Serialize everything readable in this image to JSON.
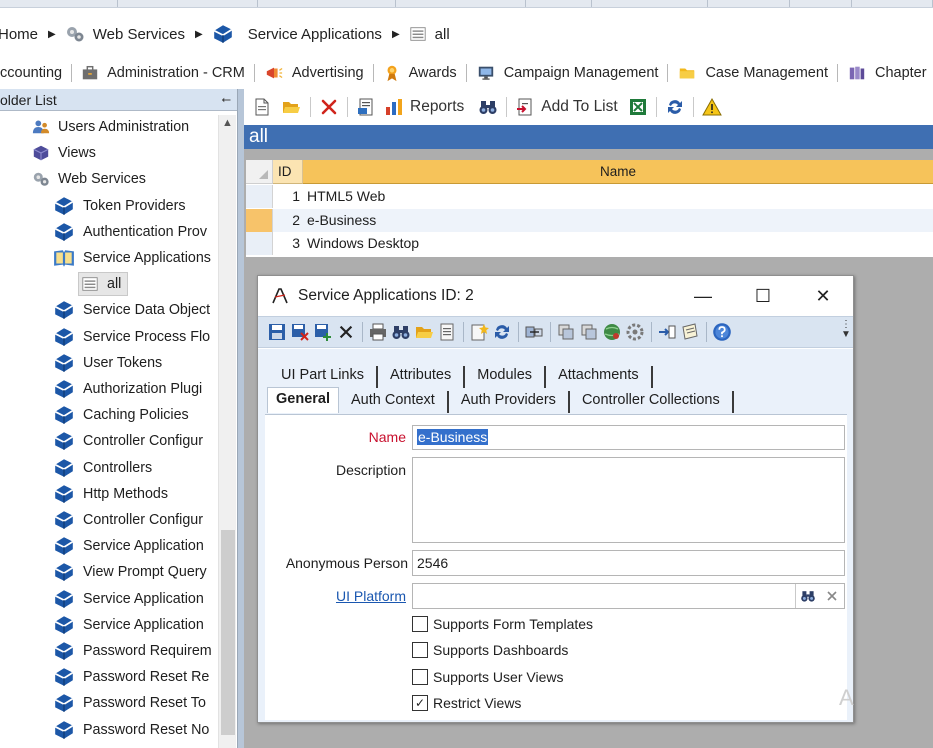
{
  "breadcrumb": {
    "items": [
      {
        "label": "Home",
        "icon": "home-icon"
      },
      {
        "label": "Web Services",
        "icon": "gears-icon"
      },
      {
        "label": "Service Applications",
        "icon": "book-icon"
      },
      {
        "label": "all",
        "icon": "list-view-icon"
      }
    ]
  },
  "navbar": {
    "items": [
      {
        "label": "ccounting",
        "icon": "none"
      },
      {
        "label": "Administration - CRM",
        "icon": "briefcase-icon"
      },
      {
        "label": "Advertising",
        "icon": "megaphone-icon"
      },
      {
        "label": "Awards",
        "icon": "ribbon-icon"
      },
      {
        "label": "Campaign Management",
        "icon": "monitor-icon"
      },
      {
        "label": "Case Management",
        "icon": "folder-icon"
      },
      {
        "label": "Chapter",
        "icon": "books-icon"
      }
    ]
  },
  "folder_panel": {
    "title": "older List",
    "items": [
      {
        "label": "Users Administration",
        "icon": "users-icon",
        "level": 1
      },
      {
        "label": "Views",
        "icon": "cube-icon",
        "level": 1
      },
      {
        "label": "Web Services",
        "icon": "gears-icon",
        "level": 1
      },
      {
        "label": "Token Providers",
        "icon": "book-icon",
        "level": 2
      },
      {
        "label": "Authentication Prov",
        "icon": "book-icon",
        "level": 2
      },
      {
        "label": "Service Applications",
        "icon": "open-book-icon",
        "level": 2
      },
      {
        "label": "all",
        "icon": "list-view-icon",
        "level": 3,
        "selected": true
      },
      {
        "label": "Service Data Object",
        "icon": "book-icon",
        "level": 2
      },
      {
        "label": "Service Process Flo",
        "icon": "book-icon",
        "level": 2
      },
      {
        "label": "User Tokens",
        "icon": "book-icon",
        "level": 2
      },
      {
        "label": "Authorization Plugi",
        "icon": "book-icon",
        "level": 2
      },
      {
        "label": "Caching Policies",
        "icon": "book-icon",
        "level": 2
      },
      {
        "label": "Controller Configur",
        "icon": "book-icon",
        "level": 2
      },
      {
        "label": "Controllers",
        "icon": "book-icon",
        "level": 2
      },
      {
        "label": "Http Methods",
        "icon": "book-icon",
        "level": 2
      },
      {
        "label": "Controller Configur",
        "icon": "book-icon",
        "level": 2
      },
      {
        "label": "Service Application",
        "icon": "book-icon",
        "level": 2
      },
      {
        "label": "View Prompt Query",
        "icon": "book-icon",
        "level": 2
      },
      {
        "label": "Service Application",
        "icon": "book-icon",
        "level": 2
      },
      {
        "label": "Service Application",
        "icon": "book-icon",
        "level": 2
      },
      {
        "label": "Password Requirem",
        "icon": "book-icon",
        "level": 2
      },
      {
        "label": "Password Reset Re",
        "icon": "book-icon",
        "level": 2
      },
      {
        "label": "Password Reset To",
        "icon": "book-icon",
        "level": 2
      },
      {
        "label": "Password Reset No",
        "icon": "book-icon",
        "level": 2
      }
    ]
  },
  "toolbar": {
    "reports_label": "Reports",
    "add_to_list_label": "Add To List"
  },
  "view_title": "all",
  "grid": {
    "columns": [
      "ID",
      "Name"
    ],
    "rows": [
      {
        "id": "1",
        "name": "HTML5 Web"
      },
      {
        "id": "2",
        "name": "e-Business",
        "active": true
      },
      {
        "id": "3",
        "name": "Windows Desktop"
      }
    ]
  },
  "dialog": {
    "title": "Service Applications ID: 2",
    "tabs_row1": [
      "UI Part Links",
      "Attributes",
      "Modules",
      "Attachments"
    ],
    "tabs_row2": [
      "General",
      "Auth Context",
      "Auth Providers",
      "Controller Collections"
    ],
    "active_tab": "General",
    "fields": {
      "name_label": "Name",
      "name_value": "e-Business",
      "description_label": "Description",
      "description_value": "",
      "anonymous_person_label": "Anonymous Person",
      "anonymous_person_value": "2546",
      "ui_platform_label": "UI Platform",
      "ui_platform_value": ""
    },
    "checkboxes": [
      {
        "label": "Supports Form Templates",
        "checked": false
      },
      {
        "label": "Supports Dashboards",
        "checked": false
      },
      {
        "label": "Supports User Views",
        "checked": false
      },
      {
        "label": "Restrict Views",
        "checked": true
      }
    ]
  },
  "colors": {
    "accent_blue": "#3f6fb2",
    "grid_header": "#f6c35a",
    "required_red": "#c8102e",
    "link_blue": "#1a57b0"
  }
}
